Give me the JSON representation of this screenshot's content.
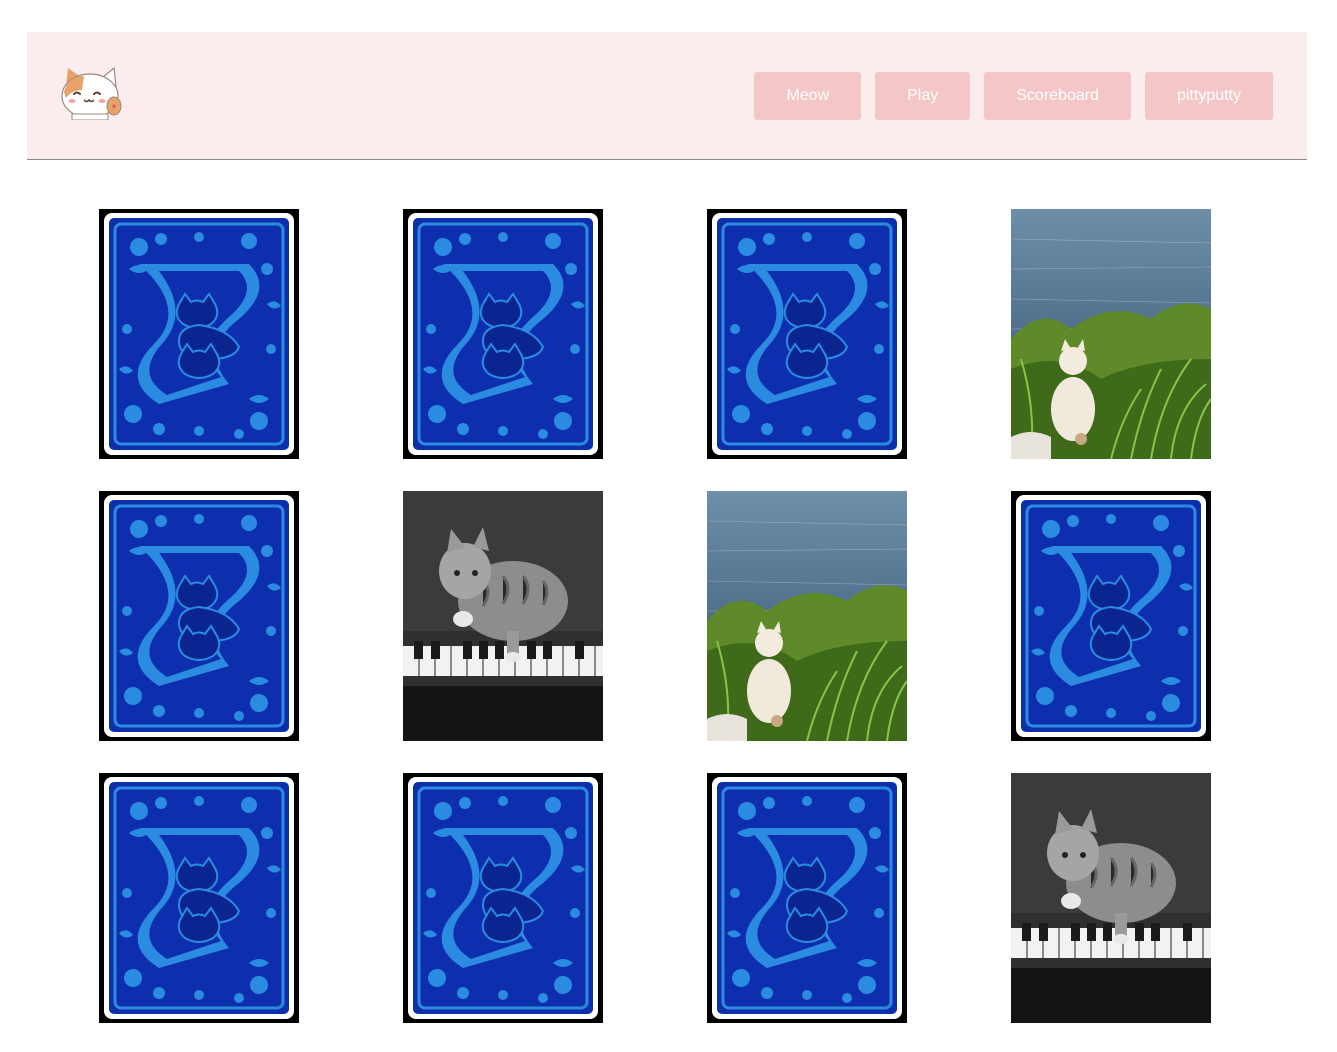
{
  "nav": {
    "logo_icon": "cat-mascot-icon",
    "buttons": [
      {
        "label": "Meow"
      },
      {
        "label": "Play"
      },
      {
        "label": "Scoreboard"
      },
      {
        "label": "pittyputty"
      }
    ]
  },
  "board": {
    "rows": 3,
    "cols": 4,
    "cards": [
      {
        "state": "face-down",
        "image": "card-back-blue-cat"
      },
      {
        "state": "face-down",
        "image": "card-back-blue-cat"
      },
      {
        "state": "face-down",
        "image": "card-back-blue-cat"
      },
      {
        "state": "face-up",
        "image": "cat-by-sea"
      },
      {
        "state": "face-down",
        "image": "card-back-blue-cat"
      },
      {
        "state": "face-up",
        "image": "kitten-on-piano"
      },
      {
        "state": "face-up",
        "image": "cat-by-sea"
      },
      {
        "state": "face-down",
        "image": "card-back-blue-cat"
      },
      {
        "state": "face-down",
        "image": "card-back-blue-cat"
      },
      {
        "state": "face-down",
        "image": "card-back-blue-cat"
      },
      {
        "state": "face-down",
        "image": "card-back-blue-cat"
      },
      {
        "state": "face-up",
        "image": "kitten-on-piano"
      }
    ]
  },
  "colors": {
    "navbar_bg": "#fbeced",
    "button_bg": "#f5c6c8",
    "button_text": "#ffffff",
    "card_back_blue": "#0d2fae",
    "card_back_pattern": "#2a8be0"
  }
}
